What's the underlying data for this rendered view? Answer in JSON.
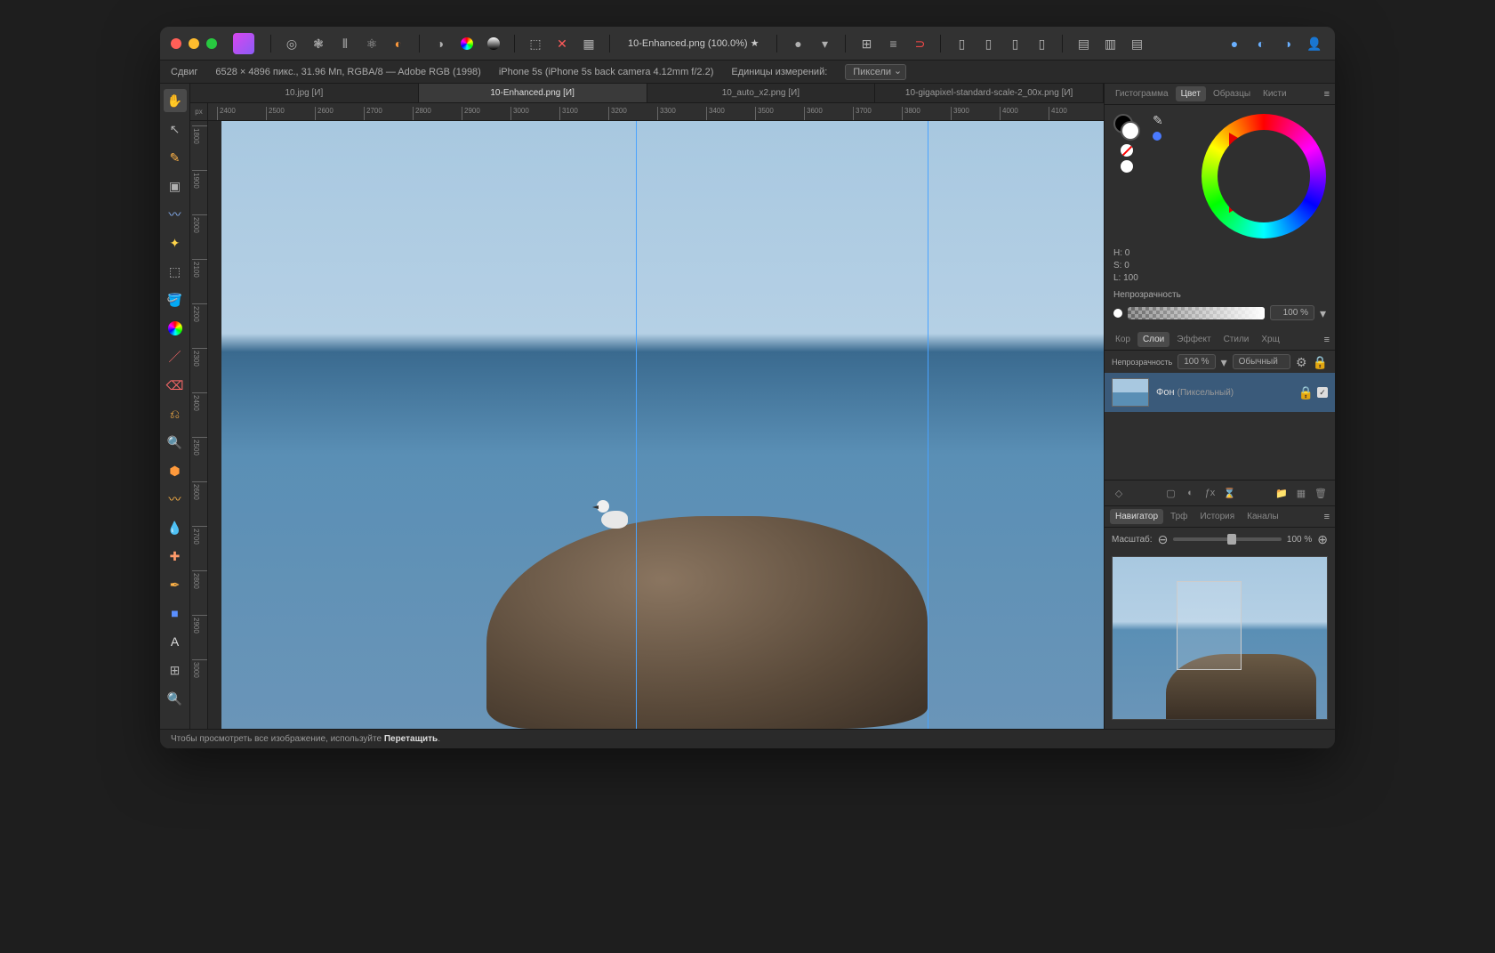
{
  "titlebar": {
    "doc_title": "10-Enhanced.png (100.0%) ★"
  },
  "infobar": {
    "tool_label": "Сдвиг",
    "dims": "6528 × 4896 пикс., 31.96 Мп, RGBA/8 — Adobe RGB (1998)",
    "camera": "iPhone 5s (iPhone 5s back camera 4.12mm f/2.2)",
    "units_label": "Единицы измерений:",
    "units_value": "Пиксели"
  },
  "doctabs": [
    "10.jpg [И]",
    "10-Enhanced.png [И]",
    "10_auto_x2.png [И]",
    "10-gigapixel-standard-scale-2_00x.png [И]"
  ],
  "ruler_unit": "px",
  "ruler_h": [
    "2400",
    "2500",
    "2600",
    "2700",
    "2800",
    "2900",
    "3000",
    "3100",
    "3200",
    "3300",
    "3400",
    "3500",
    "3600",
    "3700",
    "3800",
    "3900",
    "4000",
    "4100"
  ],
  "ruler_v": [
    "1800",
    "1900",
    "2000",
    "2100",
    "2200",
    "2300",
    "2400",
    "2500",
    "2600",
    "2700",
    "2800",
    "2900",
    "3000"
  ],
  "color_panel": {
    "tabs": [
      "Гистограмма",
      "Цвет",
      "Образцы",
      "Кисти"
    ],
    "active_tab": 1,
    "hsl": {
      "h": "H: 0",
      "s": "S: 0",
      "l": "L: 100"
    },
    "opacity_label": "Непрозрачность",
    "opacity_value": "100 %"
  },
  "layers_panel": {
    "tabs": [
      "Кор",
      "Слои",
      "Эффект",
      "Стили",
      "Хрщ"
    ],
    "active_tab": 1,
    "opacity_label": "Непрозрачность",
    "opacity_value": "100 %",
    "blend_mode": "Обычный",
    "layer": {
      "name": "Фон",
      "type": "(Пиксельный)"
    }
  },
  "nav_panel": {
    "tabs": [
      "Навигатор",
      "Трф",
      "История",
      "Каналы"
    ],
    "active_tab": 0,
    "zoom_label": "Масштаб:",
    "zoom_value": "100 %"
  },
  "status": {
    "text": "Чтобы просмотреть все изображение, используйте ",
    "action": "Перетащить",
    "suffix": "."
  }
}
